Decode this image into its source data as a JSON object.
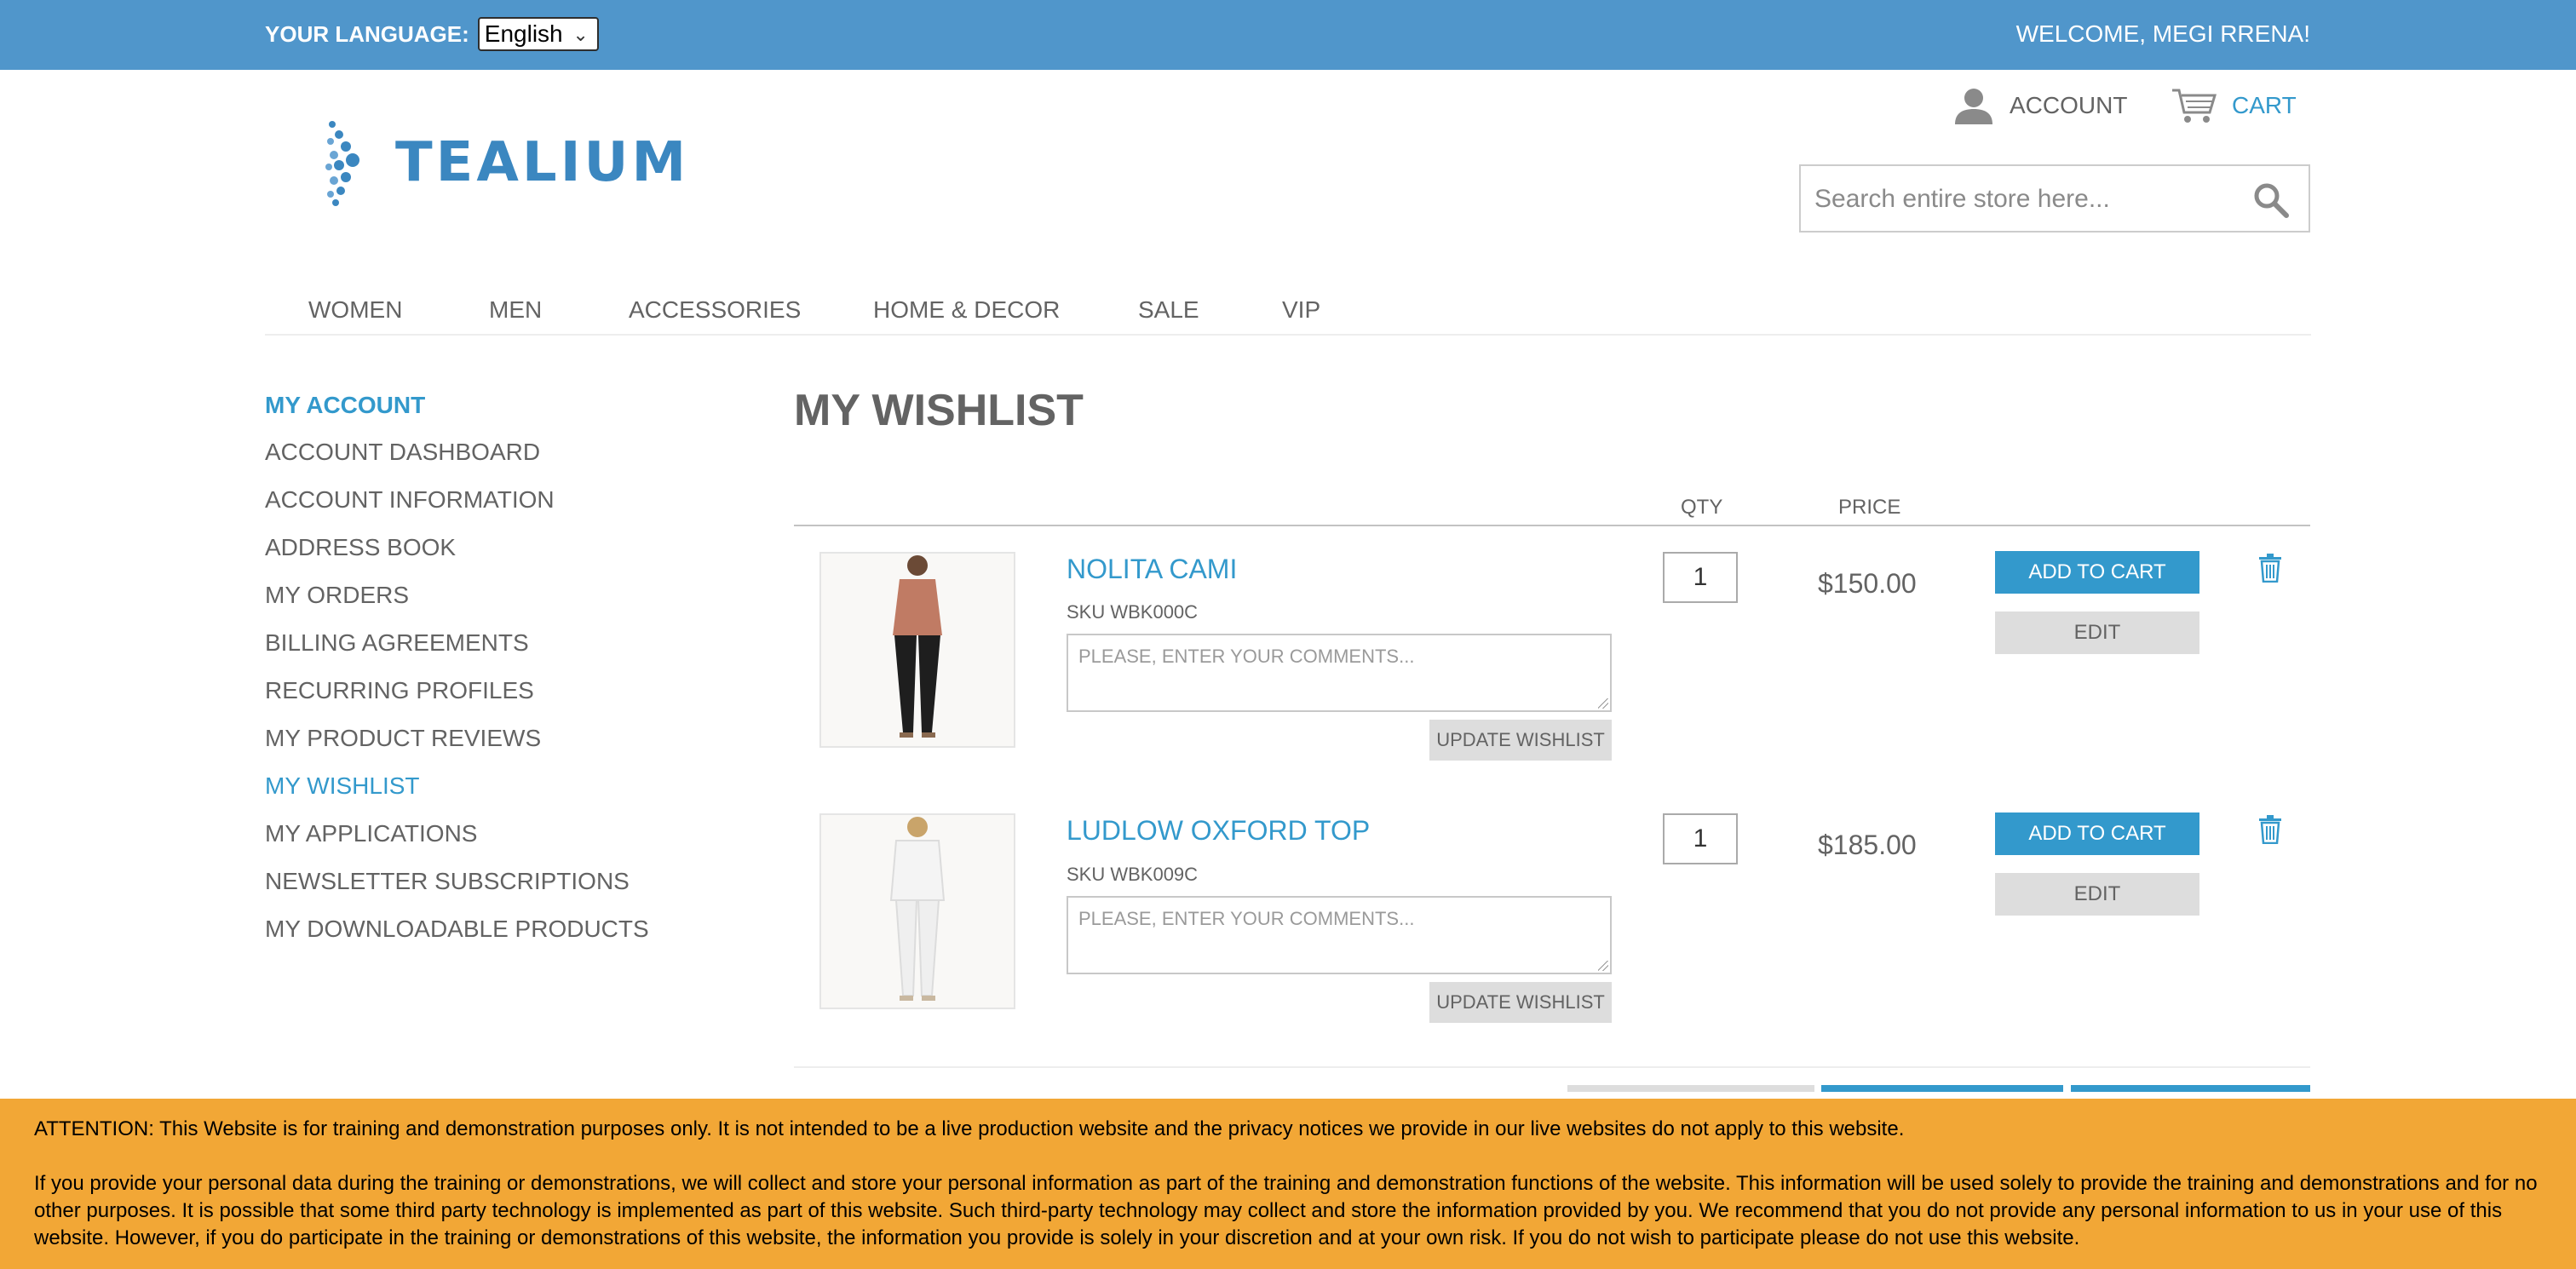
{
  "topbar": {
    "language_label": "YOUR LANGUAGE:",
    "language_value": "English",
    "welcome": "WELCOME, MEGI RRENA!",
    "color": "#5096cb"
  },
  "header": {
    "logo_text": "TEALIUM",
    "account_label": "ACCOUNT",
    "cart_label": "CART",
    "search_placeholder": "Search entire store here..."
  },
  "nav": {
    "items": [
      "WOMEN",
      "MEN",
      "ACCESSORIES",
      "HOME & DECOR",
      "SALE",
      "VIP"
    ]
  },
  "sidebar": {
    "title": "MY ACCOUNT",
    "items": [
      "ACCOUNT DASHBOARD",
      "ACCOUNT INFORMATION",
      "ADDRESS BOOK",
      "MY ORDERS",
      "BILLING AGREEMENTS",
      "RECURRING PROFILES",
      "MY PRODUCT REVIEWS",
      "MY WISHLIST",
      "MY APPLICATIONS",
      "NEWSLETTER SUBSCRIPTIONS",
      "MY DOWNLOADABLE PRODUCTS"
    ],
    "active": "MY WISHLIST"
  },
  "main": {
    "title": "MY WISHLIST",
    "col_qty": "QTY",
    "col_price": "PRICE",
    "items": [
      {
        "name": "NOLITA CAMI",
        "sku": "SKU WBK000C",
        "comment_placeholder": "PLEASE, ENTER YOUR COMMENTS...",
        "update_label": "UPDATE WISHLIST",
        "qty": "1",
        "price": "$150.00",
        "add_label": "ADD TO CART",
        "edit_label": "EDIT"
      },
      {
        "name": "LUDLOW OXFORD TOP",
        "sku": "SKU WBK009C",
        "comment_placeholder": "PLEASE, ENTER YOUR COMMENTS...",
        "update_label": "UPDATE WISHLIST",
        "qty": "1",
        "price": "$185.00",
        "add_label": "ADD TO CART",
        "edit_label": "EDIT"
      }
    ]
  },
  "banner": {
    "line1": "ATTENTION: This Website is for training and demonstration purposes only. It is not intended to be a live production website and the privacy notices we provide in our live websites do not apply to this website.",
    "line2": "If you provide your personal data during the training or demonstrations, we will collect and store your personal information as part of the training and demonstration functions of the website. This information will be used solely to provide the training and demonstrations and for no other purposes. It is possible that some third party technology is implemented as part of this website. Such third-party technology may collect and store the information provided by you. We recommend that you do not provide any personal information to us in your use of this website. However, if you do participate in the training or demonstrations of this website, the information you provide is solely in your discretion and at your own risk. If you do not wish to participate please do not use this website.",
    "color": "#f2a736"
  },
  "icons": [
    "user-icon",
    "cart-icon",
    "search-icon",
    "trash-icon",
    "chevron-down-icon"
  ]
}
